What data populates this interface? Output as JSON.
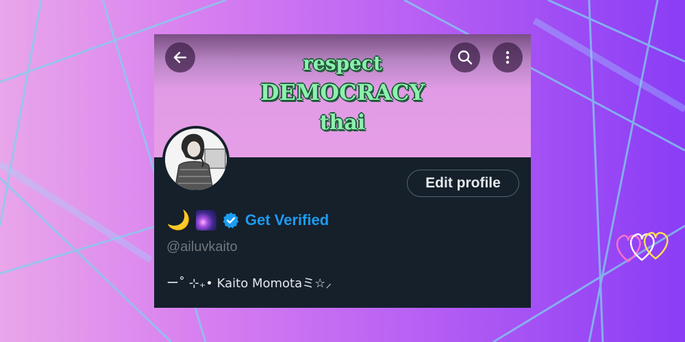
{
  "banner": {
    "line1": "respect",
    "line2": "DEMOCRACY",
    "line3": "thai"
  },
  "header_buttons": {
    "back_icon": "arrow-left-icon",
    "search_icon": "search-icon",
    "more_icon": "more-vertical-icon"
  },
  "profile": {
    "edit_button_label": "Edit profile",
    "name_emoji": "🌙",
    "galaxy_icon": "galaxy-emoji-icon",
    "verified_badge_icon": "verified-badge-icon",
    "verified_label": "Get Verified",
    "handle": "@ailuvkaito",
    "bio": "ー˚ ⊹₊• Kaito Momotaミ☆⸝"
  },
  "colors": {
    "background_left": "#e9a6ea",
    "background_right": "#8a3df5",
    "banner_text": "#8df0ae",
    "card_dark": "#15202b",
    "verified_blue": "#1d9bf0"
  }
}
